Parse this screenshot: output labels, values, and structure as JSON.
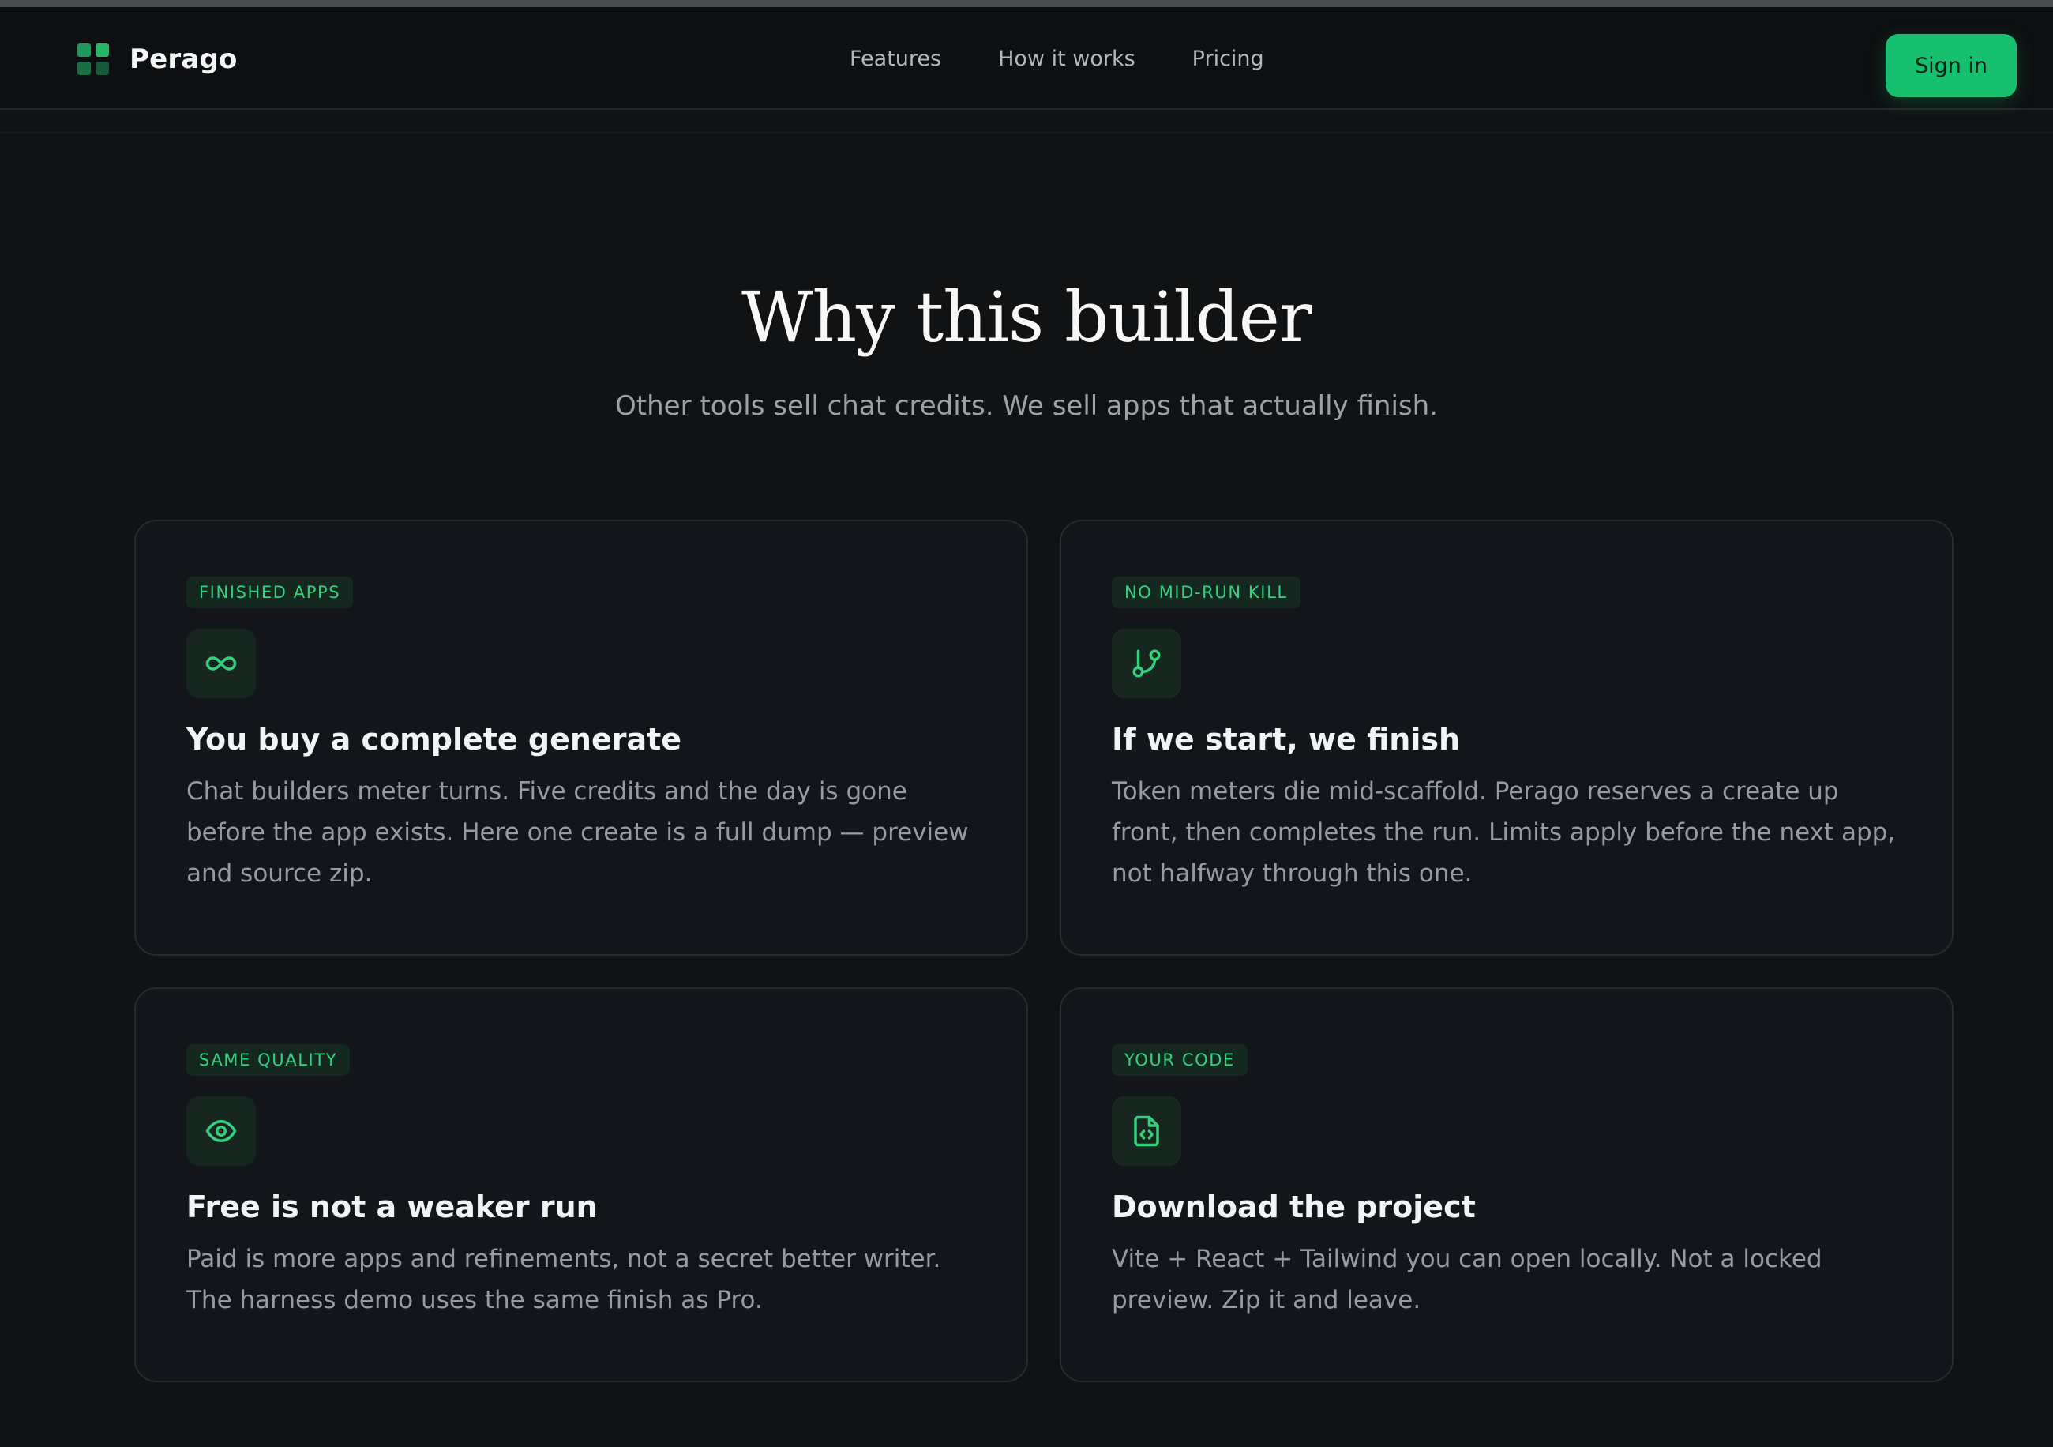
{
  "brand": {
    "name": "Perago"
  },
  "nav": {
    "items": [
      "Features",
      "How it works",
      "Pricing"
    ],
    "signin_label": "Sign in"
  },
  "hero": {
    "title": "Why this builder",
    "subtitle": "Other tools sell chat credits. We sell apps that actually finish."
  },
  "cards": [
    {
      "tag": "FINISHED APPS",
      "icon": "infinity-icon",
      "title": "You buy a complete generate",
      "body": "Chat builders meter turns. Five credits and the day is gone before the app exists. Here one create is a full dump — preview and source zip."
    },
    {
      "tag": "NO MID-RUN KILL",
      "icon": "git-branch-icon",
      "title": "If we start, we finish",
      "body": "Token meters die mid-scaffold. Perago reserves a create up front, then completes the run. Limits apply before the next app, not halfway through this one."
    },
    {
      "tag": "SAME QUALITY",
      "icon": "eye-icon",
      "title": "Free is not a weaker run",
      "body": "Paid is more apps and refinements, not a secret better writer. The harness demo uses the same finish as Pro."
    },
    {
      "tag": "YOUR CODE",
      "icon": "file-code-icon",
      "title": "Download the project",
      "body": "Vite + React + Tailwind you can open locally. Not a locked preview. Zip it and leave."
    }
  ],
  "colors": {
    "background": "#101214",
    "accent": "#16c06e",
    "tag_text": "#34d17f",
    "card_border": "#262b30"
  }
}
